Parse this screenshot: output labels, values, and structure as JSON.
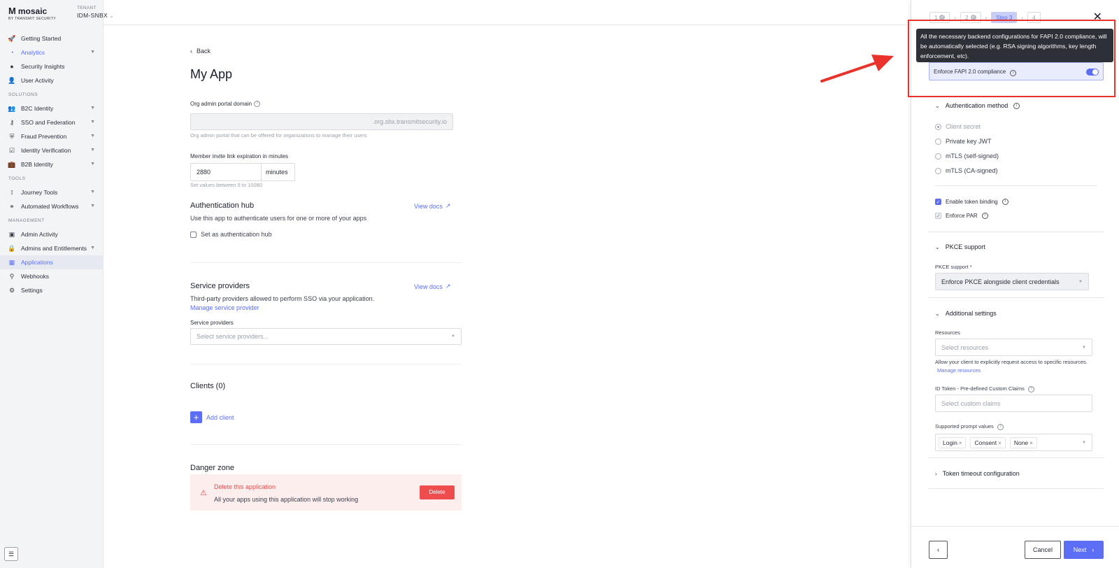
{
  "brand": {
    "name": "mosaic",
    "subtitle": "BY TRANSMIT SECURITY"
  },
  "tenant": {
    "label": "TENANT",
    "value": "IDM-SNBX"
  },
  "sidebar": {
    "items": [
      {
        "label": "Getting Started"
      },
      {
        "label": "Analytics"
      },
      {
        "label": "Security Insights"
      },
      {
        "label": "User Activity"
      }
    ],
    "solutions_label": "SOLUTIONS",
    "solutions": [
      {
        "label": "B2C Identity"
      },
      {
        "label": "SSO and Federation"
      },
      {
        "label": "Fraud Prevention"
      },
      {
        "label": "Identity Verification"
      },
      {
        "label": "B2B Identity"
      }
    ],
    "tools_label": "TOOLS",
    "tools": [
      {
        "label": "Journey Tools"
      },
      {
        "label": "Automated Workflows"
      }
    ],
    "management_label": "MANAGEMENT",
    "management": [
      {
        "label": "Admin Activity"
      },
      {
        "label": "Admins and Entitlements"
      },
      {
        "label": "Applications"
      },
      {
        "label": "Webhooks"
      },
      {
        "label": "Settings"
      }
    ]
  },
  "main": {
    "back": "Back",
    "title": "My App",
    "domain_label": "Org admin portal domain",
    "domain_suffix": ".org.sbx.transmitsecurity.io",
    "domain_hint": "Org admin portal that can be offered for organizations to manage their users",
    "invite_label": "Member invite link expiration in minutes",
    "invite_value": "2880",
    "invite_unit": "minutes",
    "invite_hint": "Set values between 5 to 10080",
    "auth_hub_title": "Authentication hub",
    "auth_hub_desc": "Use this app to authenticate users for one or more of your apps",
    "auth_hub_checkbox": "Set as authentication hub",
    "view_docs": "View docs",
    "sp_title": "Service providers",
    "sp_desc": "Third-party providers allowed to perform SSO via your application.",
    "sp_manage": "Manage service provider",
    "sp_label": "Service providers",
    "sp_placeholder": "Select service providers...",
    "clients_title": "Clients (0)",
    "add_client": "Add client",
    "danger_title": "Danger zone",
    "danger_heading": "Delete this application",
    "danger_desc": "All your apps using this application will stop working",
    "delete_btn": "Delete"
  },
  "panel": {
    "steps": [
      "1",
      "2",
      "Step 3",
      "4"
    ],
    "tooltip": "All the necessary backend configurations for FAPI 2.0 compliance, will be automatically selected (e.g. RSA signing algorithms, key length enforcement, etc).",
    "fapi_label": "Enforce FAPI 2.0 compliance",
    "auth_method_title": "Authentication method",
    "auth_methods": [
      "Client secret",
      "Private key JWT",
      "mTLS (self-signed)",
      "mTLS (CA-signed)"
    ],
    "token_binding": "Enable token binding",
    "enforce_par": "Enforce PAR",
    "pkce_title": "PKCE support",
    "pkce_label": "PKCE support *",
    "pkce_value": "Enforce PKCE alongside client credentials",
    "additional_title": "Additional settings",
    "resources_label": "Resources",
    "resources_placeholder": "Select resources",
    "resources_help": "Allow your client to explicitly request access to specific resources.",
    "manage_resources": "Manage resources",
    "claims_label": "ID Token - Pre-defined Custom Claims",
    "claims_placeholder": "Select custom claims",
    "prompt_label": "Supported prompt values",
    "prompt_values": [
      "Login",
      "Consent",
      "None"
    ],
    "token_timeout_title": "Token timeout configuration",
    "cancel": "Cancel",
    "next": "Next"
  },
  "colors": {
    "accent": "#5b6ef5",
    "danger": "#ef4d4d",
    "annotation": "#e8322a"
  }
}
